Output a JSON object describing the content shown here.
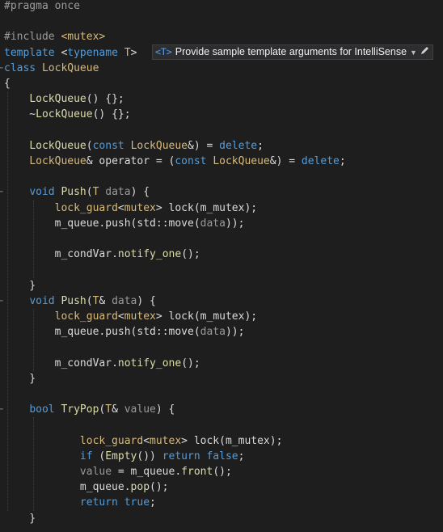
{
  "code": {
    "lines": [
      {
        "tokens": [
          {
            "t": "#pragma once",
            "c": "pp"
          }
        ]
      },
      {
        "tokens": []
      },
      {
        "tokens": [
          {
            "t": "#include ",
            "c": "pp"
          },
          {
            "t": "<mutex>",
            "c": "ty"
          }
        ]
      },
      {
        "tokens": [
          {
            "t": "template ",
            "c": "kw"
          },
          {
            "t": "<",
            "c": "pl"
          },
          {
            "t": "typename",
            "c": "kw"
          },
          {
            "t": " ",
            "c": "pl"
          },
          {
            "t": "T",
            "c": "ty"
          },
          {
            "t": ">",
            "c": "pl"
          }
        ]
      },
      {
        "tokens": [
          {
            "t": "class ",
            "c": "kw"
          },
          {
            "t": "LockQueue",
            "c": "ty"
          }
        ]
      },
      {
        "tokens": [
          {
            "t": "{",
            "c": "pl"
          }
        ]
      },
      {
        "tokens": [
          {
            "t": "    ",
            "c": "pl"
          },
          {
            "t": "LockQueue",
            "c": "fn"
          },
          {
            "t": "() {};",
            "c": "pl"
          }
        ]
      },
      {
        "tokens": [
          {
            "t": "    ~",
            "c": "pl"
          },
          {
            "t": "LockQueue",
            "c": "fn"
          },
          {
            "t": "() {};",
            "c": "pl"
          }
        ]
      },
      {
        "tokens": []
      },
      {
        "tokens": [
          {
            "t": "    ",
            "c": "pl"
          },
          {
            "t": "LockQueue",
            "c": "fn"
          },
          {
            "t": "(",
            "c": "pl"
          },
          {
            "t": "const ",
            "c": "kw"
          },
          {
            "t": "LockQueue",
            "c": "ty"
          },
          {
            "t": "&) = ",
            "c": "pl"
          },
          {
            "t": "delete",
            "c": "kw"
          },
          {
            "t": ";",
            "c": "pl"
          }
        ]
      },
      {
        "tokens": [
          {
            "t": "    ",
            "c": "pl"
          },
          {
            "t": "LockQueue",
            "c": "ty"
          },
          {
            "t": "& operator = (",
            "c": "pl"
          },
          {
            "t": "const ",
            "c": "kw"
          },
          {
            "t": "LockQueue",
            "c": "ty"
          },
          {
            "t": "&) = ",
            "c": "pl"
          },
          {
            "t": "delete",
            "c": "kw"
          },
          {
            "t": ";",
            "c": "pl"
          }
        ]
      },
      {
        "tokens": []
      },
      {
        "tokens": [
          {
            "t": "    ",
            "c": "pl"
          },
          {
            "t": "void ",
            "c": "kw"
          },
          {
            "t": "Push",
            "c": "fn"
          },
          {
            "t": "(",
            "c": "pl"
          },
          {
            "t": "T",
            "c": "ty"
          },
          {
            "t": " ",
            "c": "pl"
          },
          {
            "t": "data",
            "c": "pa"
          },
          {
            "t": ") {",
            "c": "pl"
          }
        ]
      },
      {
        "tokens": [
          {
            "t": "        ",
            "c": "pl"
          },
          {
            "t": "lock_guard",
            "c": "ty"
          },
          {
            "t": "<",
            "c": "pl"
          },
          {
            "t": "mutex",
            "c": "ty"
          },
          {
            "t": "> ",
            "c": "pl"
          },
          {
            "t": "lock",
            "c": "mb"
          },
          {
            "t": "(",
            "c": "pl"
          },
          {
            "t": "m_mutex",
            "c": "mb"
          },
          {
            "t": ");",
            "c": "pl"
          }
        ]
      },
      {
        "tokens": [
          {
            "t": "        ",
            "c": "pl"
          },
          {
            "t": "m_queue",
            "c": "mb"
          },
          {
            "t": ".push(std::",
            "c": "pl"
          },
          {
            "t": "move",
            "c": "mb"
          },
          {
            "t": "(",
            "c": "pl"
          },
          {
            "t": "data",
            "c": "pa"
          },
          {
            "t": "));",
            "c": "pl"
          }
        ]
      },
      {
        "tokens": []
      },
      {
        "tokens": [
          {
            "t": "        ",
            "c": "pl"
          },
          {
            "t": "m_condVar",
            "c": "mb"
          },
          {
            "t": ".",
            "c": "pl"
          },
          {
            "t": "notify_one",
            "c": "fn"
          },
          {
            "t": "();",
            "c": "pl"
          }
        ]
      },
      {
        "tokens": []
      },
      {
        "tokens": [
          {
            "t": "    }",
            "c": "pl"
          }
        ]
      },
      {
        "tokens": [
          {
            "t": "    ",
            "c": "pl"
          },
          {
            "t": "void ",
            "c": "kw"
          },
          {
            "t": "Push",
            "c": "fn"
          },
          {
            "t": "(",
            "c": "pl"
          },
          {
            "t": "T",
            "c": "ty"
          },
          {
            "t": "& ",
            "c": "pl"
          },
          {
            "t": "data",
            "c": "pa"
          },
          {
            "t": ") {",
            "c": "pl"
          }
        ]
      },
      {
        "tokens": [
          {
            "t": "        ",
            "c": "pl"
          },
          {
            "t": "lock_guard",
            "c": "ty"
          },
          {
            "t": "<",
            "c": "pl"
          },
          {
            "t": "mutex",
            "c": "ty"
          },
          {
            "t": "> ",
            "c": "pl"
          },
          {
            "t": "lock",
            "c": "mb"
          },
          {
            "t": "(",
            "c": "pl"
          },
          {
            "t": "m_mutex",
            "c": "mb"
          },
          {
            "t": ");",
            "c": "pl"
          }
        ]
      },
      {
        "tokens": [
          {
            "t": "        ",
            "c": "pl"
          },
          {
            "t": "m_queue",
            "c": "mb"
          },
          {
            "t": ".push(std::",
            "c": "pl"
          },
          {
            "t": "move",
            "c": "mb"
          },
          {
            "t": "(",
            "c": "pl"
          },
          {
            "t": "data",
            "c": "pa"
          },
          {
            "t": "));",
            "c": "pl"
          }
        ]
      },
      {
        "tokens": []
      },
      {
        "tokens": [
          {
            "t": "        ",
            "c": "pl"
          },
          {
            "t": "m_condVar",
            "c": "mb"
          },
          {
            "t": ".",
            "c": "pl"
          },
          {
            "t": "notify_one",
            "c": "fn"
          },
          {
            "t": "();",
            "c": "pl"
          }
        ]
      },
      {
        "tokens": [
          {
            "t": "    }",
            "c": "pl"
          }
        ]
      },
      {
        "tokens": []
      },
      {
        "tokens": [
          {
            "t": "    ",
            "c": "pl"
          },
          {
            "t": "bool ",
            "c": "kw"
          },
          {
            "t": "TryPop",
            "c": "fn"
          },
          {
            "t": "(",
            "c": "pl"
          },
          {
            "t": "T",
            "c": "ty"
          },
          {
            "t": "& ",
            "c": "pl"
          },
          {
            "t": "value",
            "c": "pa"
          },
          {
            "t": ") {",
            "c": "pl"
          }
        ]
      },
      {
        "tokens": []
      },
      {
        "tokens": [
          {
            "t": "            ",
            "c": "pl"
          },
          {
            "t": "lock_guard",
            "c": "ty"
          },
          {
            "t": "<",
            "c": "pl"
          },
          {
            "t": "mutex",
            "c": "ty"
          },
          {
            "t": "> ",
            "c": "pl"
          },
          {
            "t": "lock",
            "c": "mb"
          },
          {
            "t": "(",
            "c": "pl"
          },
          {
            "t": "m_mutex",
            "c": "mb"
          },
          {
            "t": ");",
            "c": "pl"
          }
        ]
      },
      {
        "tokens": [
          {
            "t": "            ",
            "c": "pl"
          },
          {
            "t": "if ",
            "c": "kw"
          },
          {
            "t": "(",
            "c": "pl"
          },
          {
            "t": "Empty",
            "c": "fn"
          },
          {
            "t": "()) ",
            "c": "pl"
          },
          {
            "t": "return ",
            "c": "kw"
          },
          {
            "t": "false",
            "c": "kw"
          },
          {
            "t": ";",
            "c": "pl"
          }
        ]
      },
      {
        "tokens": [
          {
            "t": "            ",
            "c": "pl"
          },
          {
            "t": "value",
            "c": "pa"
          },
          {
            "t": " = ",
            "c": "pl"
          },
          {
            "t": "m_queue",
            "c": "mb"
          },
          {
            "t": ".",
            "c": "pl"
          },
          {
            "t": "front",
            "c": "fn"
          },
          {
            "t": "();",
            "c": "pl"
          }
        ]
      },
      {
        "tokens": [
          {
            "t": "            ",
            "c": "pl"
          },
          {
            "t": "m_queue",
            "c": "mb"
          },
          {
            "t": ".",
            "c": "pl"
          },
          {
            "t": "pop",
            "c": "fn"
          },
          {
            "t": "();",
            "c": "pl"
          }
        ]
      },
      {
        "tokens": [
          {
            "t": "            ",
            "c": "pl"
          },
          {
            "t": "return ",
            "c": "kw"
          },
          {
            "t": "true",
            "c": "kw"
          },
          {
            "t": ";",
            "c": "pl"
          }
        ]
      },
      {
        "tokens": [
          {
            "t": "    }",
            "c": "pl"
          }
        ]
      }
    ],
    "fold_lines": [
      4,
      12,
      19,
      26
    ]
  },
  "codelens": {
    "tag": "<T>",
    "label": "Provide sample template arguments for IntelliSense",
    "dropdown_icon": "chevron-down-icon",
    "edit_icon": "pencil-icon"
  },
  "colors": {
    "background": "#1e1e1e",
    "keyword": "#569cd6",
    "type": "#d7ba7d",
    "function": "#dcdcaa",
    "preprocessor": "#9b9b9b",
    "parameter": "#9a9a9a"
  }
}
